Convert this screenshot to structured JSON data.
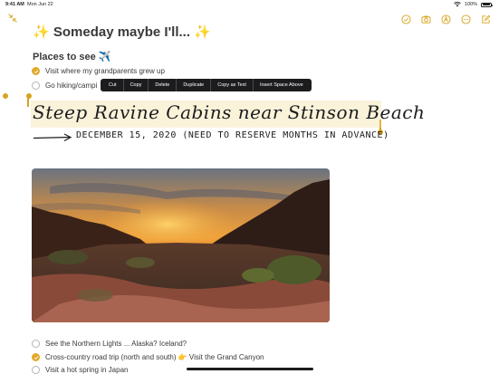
{
  "status_bar": {
    "time": "9:41 AM",
    "date": "Mon Jun 22",
    "battery": "100%"
  },
  "toolbar": {
    "left_icon": "collapse-arrows-icon",
    "right_icons": [
      "checklist-icon",
      "camera-icon",
      "markup-icon",
      "more-icon",
      "compose-icon"
    ]
  },
  "note": {
    "title": "Someday maybe I'll...",
    "title_emoji_left": "✨",
    "title_emoji_right": "✨",
    "section_heading": "Places to see ✈️",
    "checklist_top": [
      {
        "label": "Visit where my grandparents grew up",
        "done": true
      },
      {
        "label": "Go hiking/campi",
        "done": false
      }
    ],
    "handwriting_line1": "Steep Ravine Cabins near Stinson Beach",
    "handwriting_line2": "DECEMBER 15, 2020 (NEED TO RESERVE MONTHS IN ADVANCE)",
    "checklist_bottom": [
      {
        "label": "See the Northern Lights ... Alaska? Iceland?",
        "done": false
      },
      {
        "label": "Cross-country road trip (north and south) 👉 Visit the Grand Canyon",
        "done": true
      },
      {
        "label": "Visit a hot spring in Japan",
        "done": false
      }
    ]
  },
  "edit_menu": {
    "items": [
      "Cut",
      "Copy",
      "Delete",
      "Duplicate",
      "Copy as Text",
      "Insert Space Above"
    ]
  },
  "colors": {
    "accent": "#d8a31d",
    "check_done": "#e3a92a",
    "menu_bg": "#1c1c1e"
  }
}
